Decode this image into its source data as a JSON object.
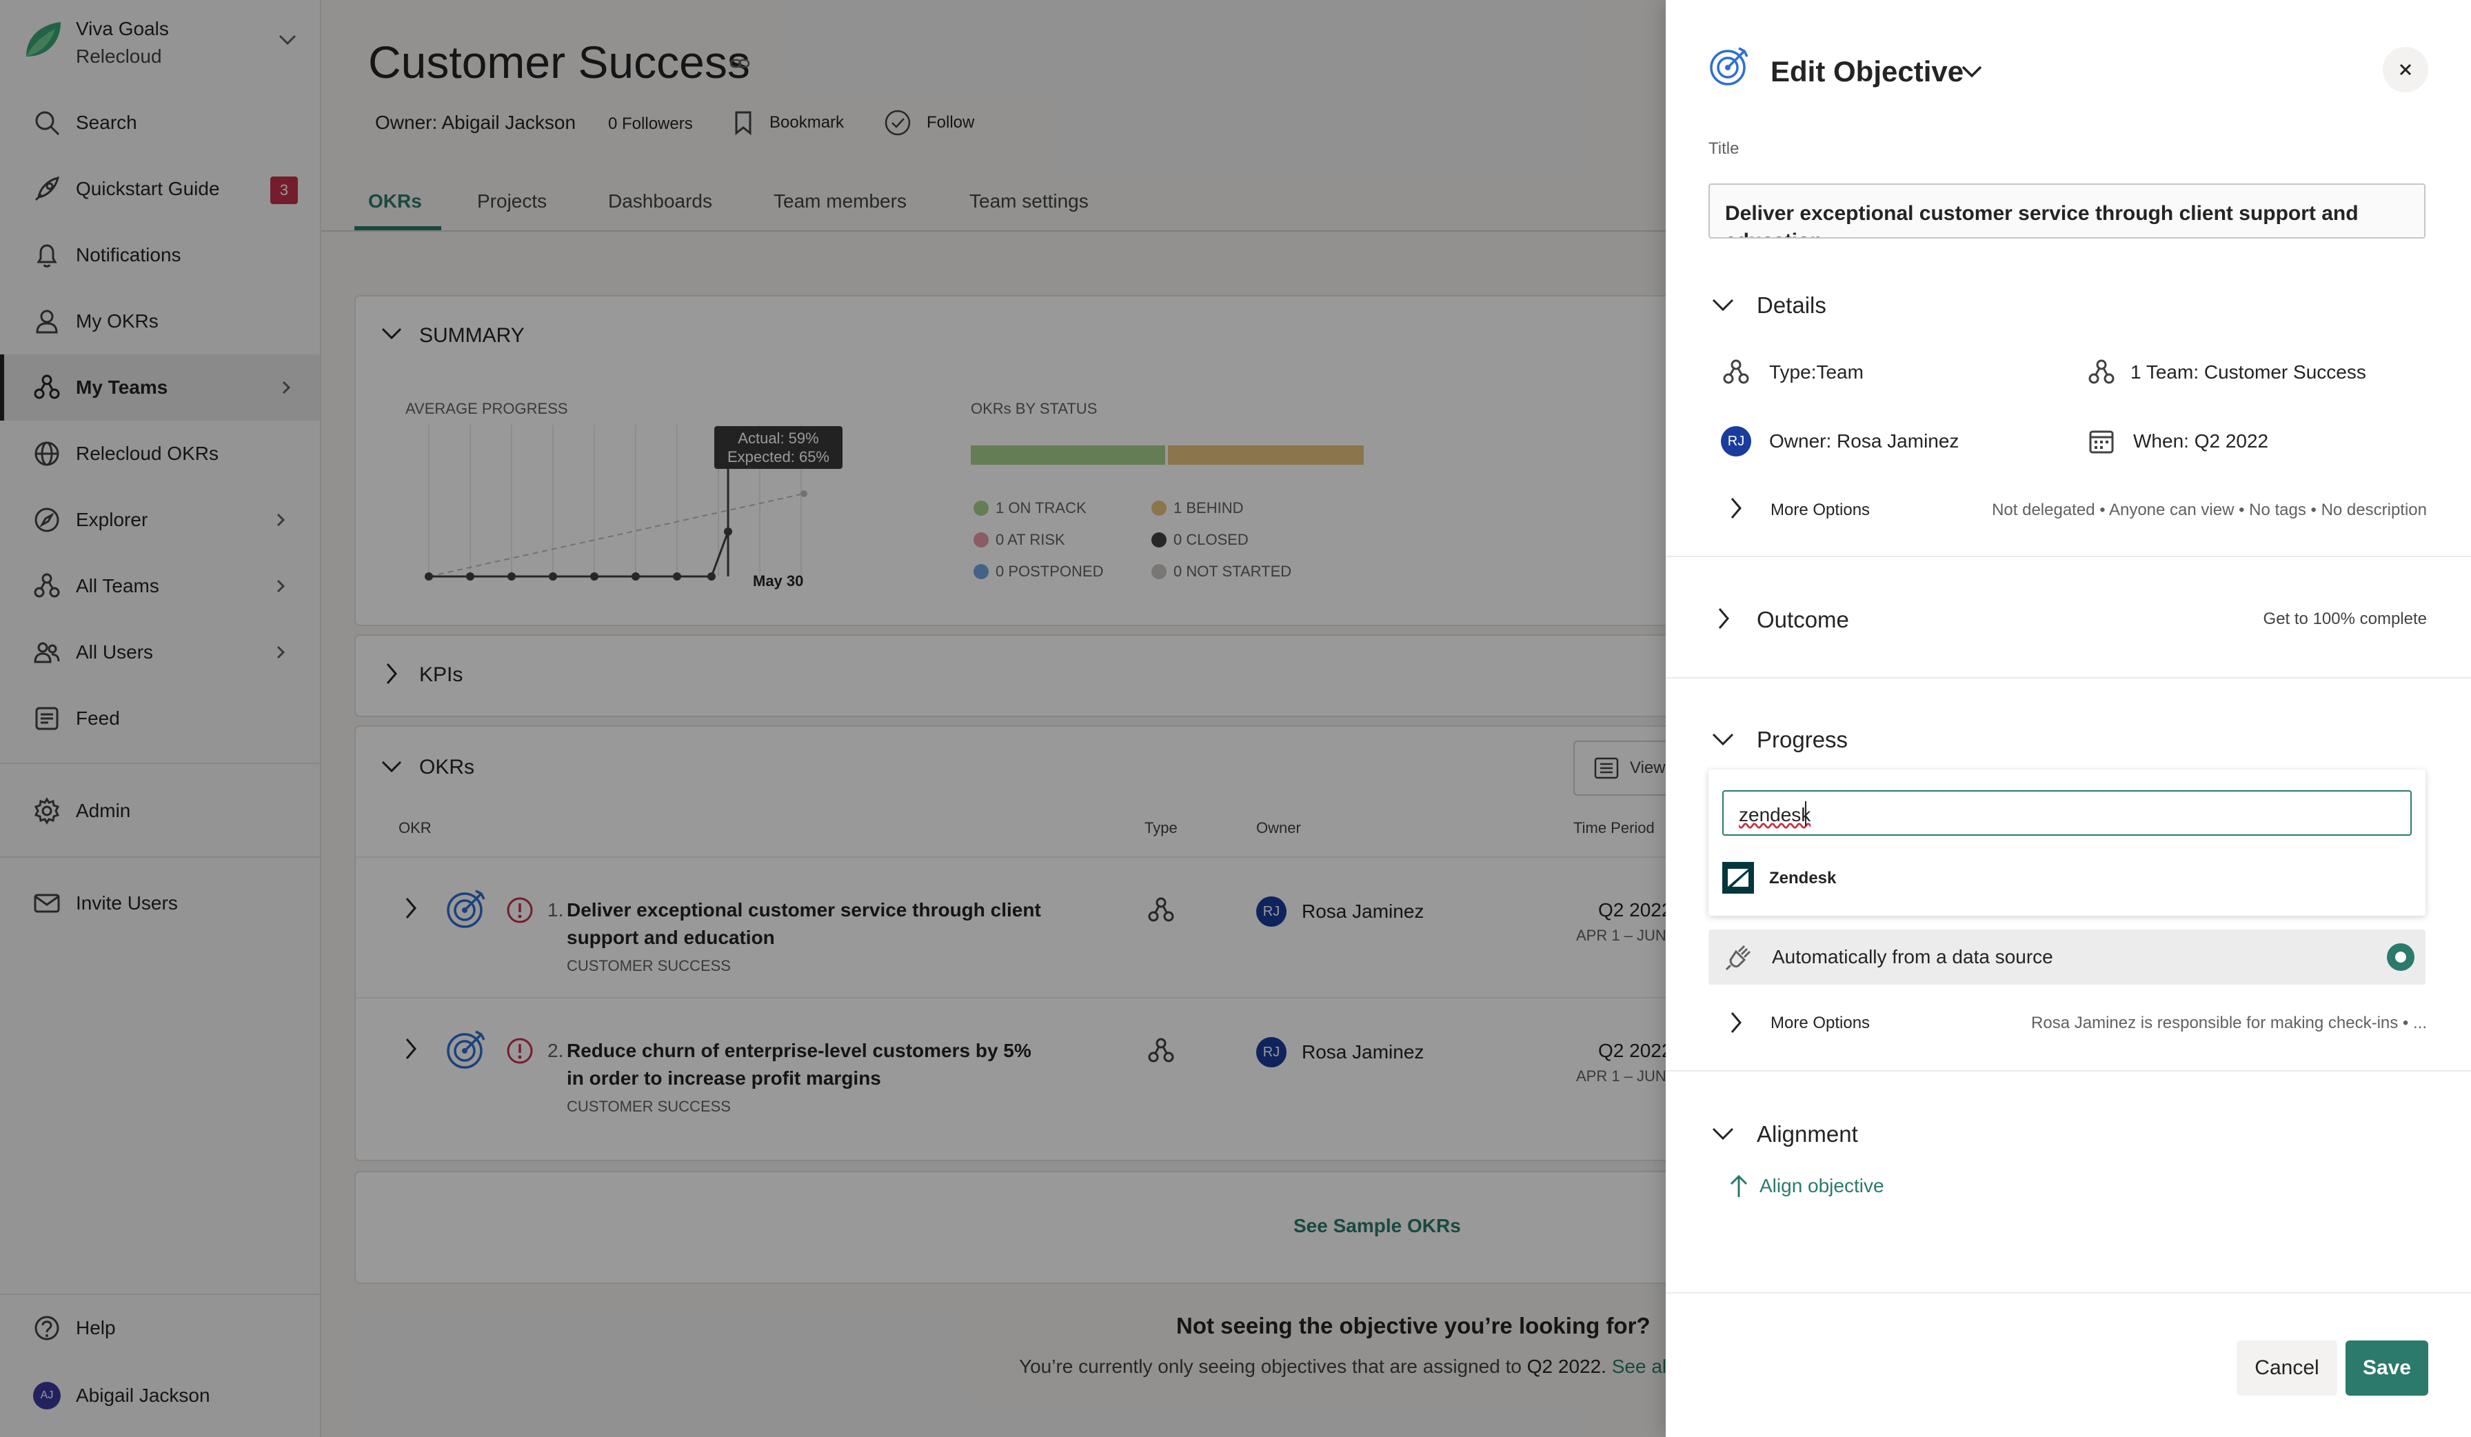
{
  "sidebar": {
    "app_name": "Viva Goals",
    "org_name": "Relecloud",
    "items": [
      {
        "label": "Search"
      },
      {
        "label": "Quickstart Guide",
        "badge": "3"
      },
      {
        "label": "Notifications"
      },
      {
        "label": "My OKRs"
      },
      {
        "label": "My Teams"
      },
      {
        "label": "Relecloud OKRs"
      },
      {
        "label": "Explorer"
      },
      {
        "label": "All Teams"
      },
      {
        "label": "All Users"
      },
      {
        "label": "Feed"
      },
      {
        "label": "Admin"
      },
      {
        "label": "Invite Users"
      }
    ],
    "help_label": "Help",
    "user": {
      "initials": "AJ",
      "name": "Abigail Jackson"
    }
  },
  "team": {
    "title": "Customer Success",
    "owner": "Owner: Abigail Jackson",
    "followers": "0 Followers",
    "bookmark": "Bookmark",
    "follow": "Follow",
    "tabs": [
      "OKRs",
      "Projects",
      "Dashboards",
      "Team members",
      "Team settings"
    ]
  },
  "summary": {
    "title": "SUMMARY",
    "avg_progress_label": "AVERAGE PROGRESS",
    "tooltip_actual": "Actual: 59%",
    "tooltip_expected": "Expected: 65%",
    "date_label": "May 30",
    "status_title": "OKRs BY STATUS",
    "status": [
      {
        "label": "1 ON TRACK",
        "color": "#a8d08d"
      },
      {
        "label": "1 BEHIND",
        "color": "#e8c37f"
      },
      {
        "label": "0 AT RISK",
        "color": "#e89aa7"
      },
      {
        "label": "0 CLOSED",
        "color": "#424242"
      },
      {
        "label": "0 POSTPONED",
        "color": "#6ea6e0"
      },
      {
        "label": "0 NOT STARTED",
        "color": "#c8c6c4"
      }
    ]
  },
  "kpis": {
    "title": "KPIs"
  },
  "okrs": {
    "title": "OKRs",
    "view_label": "View",
    "columns": [
      "OKR",
      "Type",
      "Owner",
      "Time Period"
    ],
    "rows": [
      {
        "num": "1.",
        "line1": "Deliver exceptional customer service through client",
        "line2": "support and education",
        "team": "CUSTOMER SUCCESS",
        "owner_initials": "RJ",
        "owner": "Rosa Jaminez",
        "period": "Q2 2022",
        "period_range": "APR 1 – JUN"
      },
      {
        "num": "2.",
        "line1": "Reduce churn of enterprise-level customers by 5%",
        "line2": "in order to increase profit margins",
        "team": "CUSTOMER SUCCESS",
        "owner_initials": "RJ",
        "owner": "Rosa Jaminez",
        "period": "Q2 2022",
        "period_range": "APR 1 – JUN"
      }
    ],
    "sample_link": "See Sample OKRs",
    "not_seeing_title": "Not seeing the objective you’re looking for?",
    "not_seeing_text": "You’re currently only seeing objectives that are assigned to",
    "not_seeing_quarter": "Q2 2022.",
    "see_all": "See all"
  },
  "panel": {
    "title": "Edit Objective",
    "title_label": "Title",
    "title_value": "Deliver exceptional customer service through client support and education",
    "details": {
      "header": "Details",
      "type": "Type:Team",
      "team": "1 Team: Customer Success",
      "owner_initials": "RJ",
      "owner": "Owner: Rosa Jaminez",
      "when": "When: Q2 2022",
      "more_options": "More Options",
      "summary": "Not delegated • Anyone can view • No tags • No description"
    },
    "outcome": {
      "header": "Outcome",
      "summary": "Get to 100% complete"
    },
    "progress": {
      "header": "Progress",
      "search_value": "zendesk",
      "suggestion": "Zendesk",
      "method": "Automatically from a data source",
      "more_options": "More Options",
      "summary": "Rosa Jaminez is responsible for making check-ins • ..."
    },
    "alignment": {
      "header": "Alignment",
      "link": "Align objective"
    },
    "cancel": "Cancel",
    "save": "Save",
    "accent": "#2b7a6b"
  }
}
